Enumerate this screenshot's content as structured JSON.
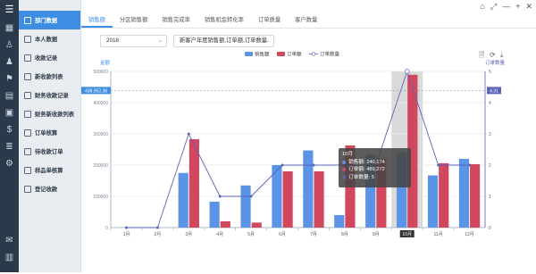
{
  "rail": {
    "icons": [
      "app-logo-icon",
      "dashboard-icon",
      "users-icon",
      "person-icon",
      "running-icon",
      "document-icon",
      "calendar-icon",
      "dollar-icon",
      "list-icon",
      "settings-icon",
      "mail-icon",
      "building-icon"
    ]
  },
  "sidebar": {
    "items": [
      {
        "label": "部门数据",
        "active": true
      },
      {
        "label": "本人数据"
      },
      {
        "label": "收款记录"
      },
      {
        "label": "新收款列表"
      },
      {
        "label": "财务收款记录"
      },
      {
        "label": "财务新收款列表"
      },
      {
        "label": "订单核算"
      },
      {
        "label": "待收款订单"
      },
      {
        "label": "样品单核算"
      },
      {
        "label": "登记收款"
      }
    ]
  },
  "window": {
    "min": "—",
    "restore": "⤢",
    "max": "+",
    "close": "✕",
    "settings": "⌂"
  },
  "tabs": [
    {
      "label": "销售额",
      "active": true
    },
    {
      "label": "分区销售额"
    },
    {
      "label": "销售完成率"
    },
    {
      "label": "销售机会转化率"
    },
    {
      "label": "订单质量"
    },
    {
      "label": "客户数量"
    }
  ],
  "filters": {
    "year": "2018",
    "metric": "新客户年度销售额,订单额,订单数量"
  },
  "legend": {
    "sales": "销售额",
    "orders": "订单额",
    "count": "订单数量"
  },
  "toolbox": {
    "doc": "🗎",
    "refresh": "⟳",
    "download": "⤓"
  },
  "pointer": {
    "left_value": "438,952.38",
    "right_value": "4.31",
    "x_label": "10月"
  },
  "tooltip": {
    "title": "10月",
    "sales_label": "销售额: 240,174",
    "orders_label": "订单额: 489,272",
    "count_label": "订单数量: 5"
  },
  "colors": {
    "sales": "#5b93e6",
    "orders": "#d0475e",
    "count": "#5a63b8"
  },
  "chart_data": {
    "type": "bar",
    "categories": [
      "1月",
      "2月",
      "3月",
      "4月",
      "5月",
      "6月",
      "7月",
      "8月",
      "9月",
      "10月",
      "11月",
      "12月"
    ],
    "ylabel": "金额",
    "y2label": "订单数量",
    "ylim": [
      0,
      500000
    ],
    "y2lim": [
      0,
      5
    ],
    "yticks": [
      "0",
      "100000",
      "200000",
      "300000",
      "400000",
      "500000"
    ],
    "y2ticks": [
      "0",
      "1",
      "2",
      "3",
      "4",
      "5"
    ],
    "series": [
      {
        "name": "销售额",
        "type": "bar",
        "values": [
          0,
          0,
          175000,
          83000,
          135000,
          200000,
          247000,
          40000,
          233000,
          240174,
          167000,
          220000
        ]
      },
      {
        "name": "订单额",
        "type": "bar",
        "values": [
          0,
          0,
          283000,
          20000,
          16000,
          180000,
          180000,
          263000,
          220000,
          489272,
          206000,
          203000
        ]
      },
      {
        "name": "订单数量",
        "type": "line",
        "axis": "right",
        "values": [
          0,
          0,
          3,
          1,
          1,
          2,
          2,
          2,
          2,
          5,
          2,
          2
        ]
      }
    ],
    "grid": true,
    "legend_position": "top-center",
    "highlighted_category": "10月"
  }
}
